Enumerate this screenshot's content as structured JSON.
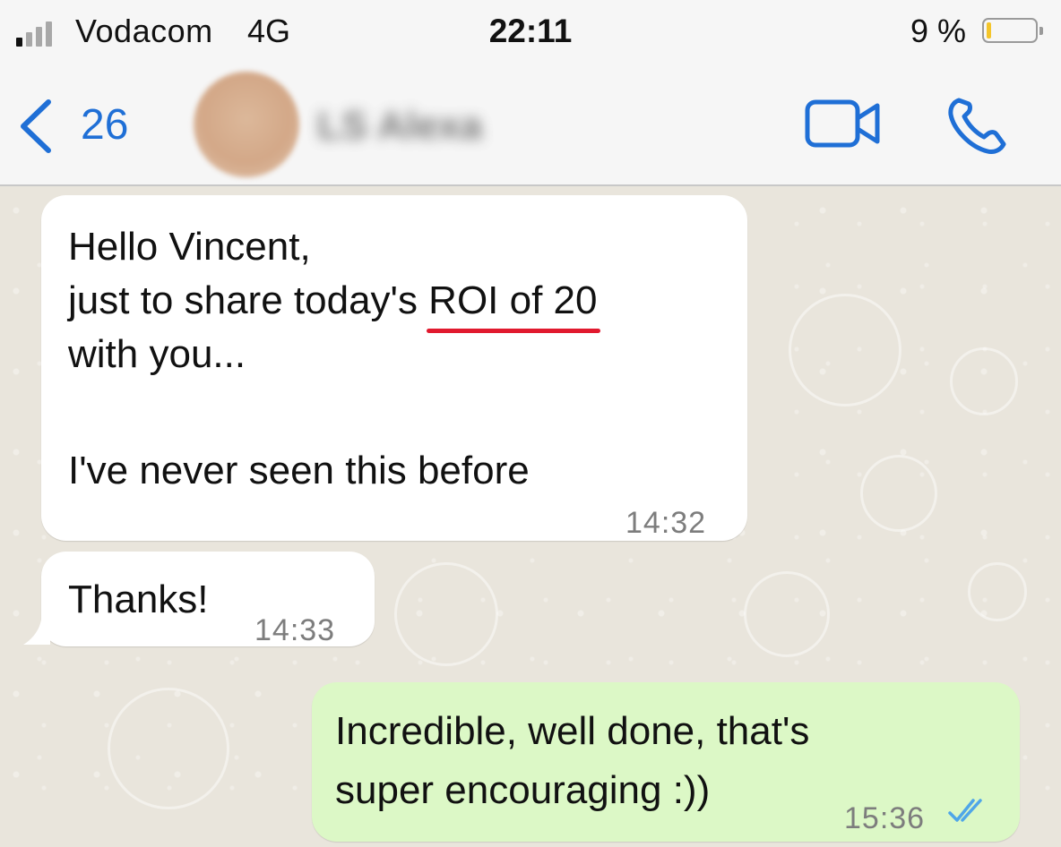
{
  "status_bar": {
    "carrier": "Vodacom",
    "network": "4G",
    "time": "22:11",
    "battery_percent": "9 %",
    "battery_level": 0.09
  },
  "header": {
    "back_count": "26",
    "contact_name": "LS Alexa",
    "icons": [
      "back-chevron-icon",
      "video-call-icon",
      "phone-call-icon"
    ]
  },
  "messages": [
    {
      "direction": "incoming",
      "lines": [
        "Hello Vincent,",
        "just to share today's ",
        "ROI of 20",
        "with you...",
        "I've never seen this before"
      ],
      "time": "14:32"
    },
    {
      "direction": "incoming",
      "lines": [
        "Thanks!"
      ],
      "time": "14:33"
    },
    {
      "direction": "outgoing",
      "lines": [
        "Incredible, well done, that's",
        "super encouraging :))"
      ],
      "time": "15:36",
      "status": "read"
    }
  ],
  "colors": {
    "accent": "#1f6fd6",
    "highlight_underline": "#e1192e",
    "outgoing_bubble": "#dcf8c6",
    "incoming_bubble": "#ffffff",
    "read_ticks": "#4fa6e8"
  }
}
